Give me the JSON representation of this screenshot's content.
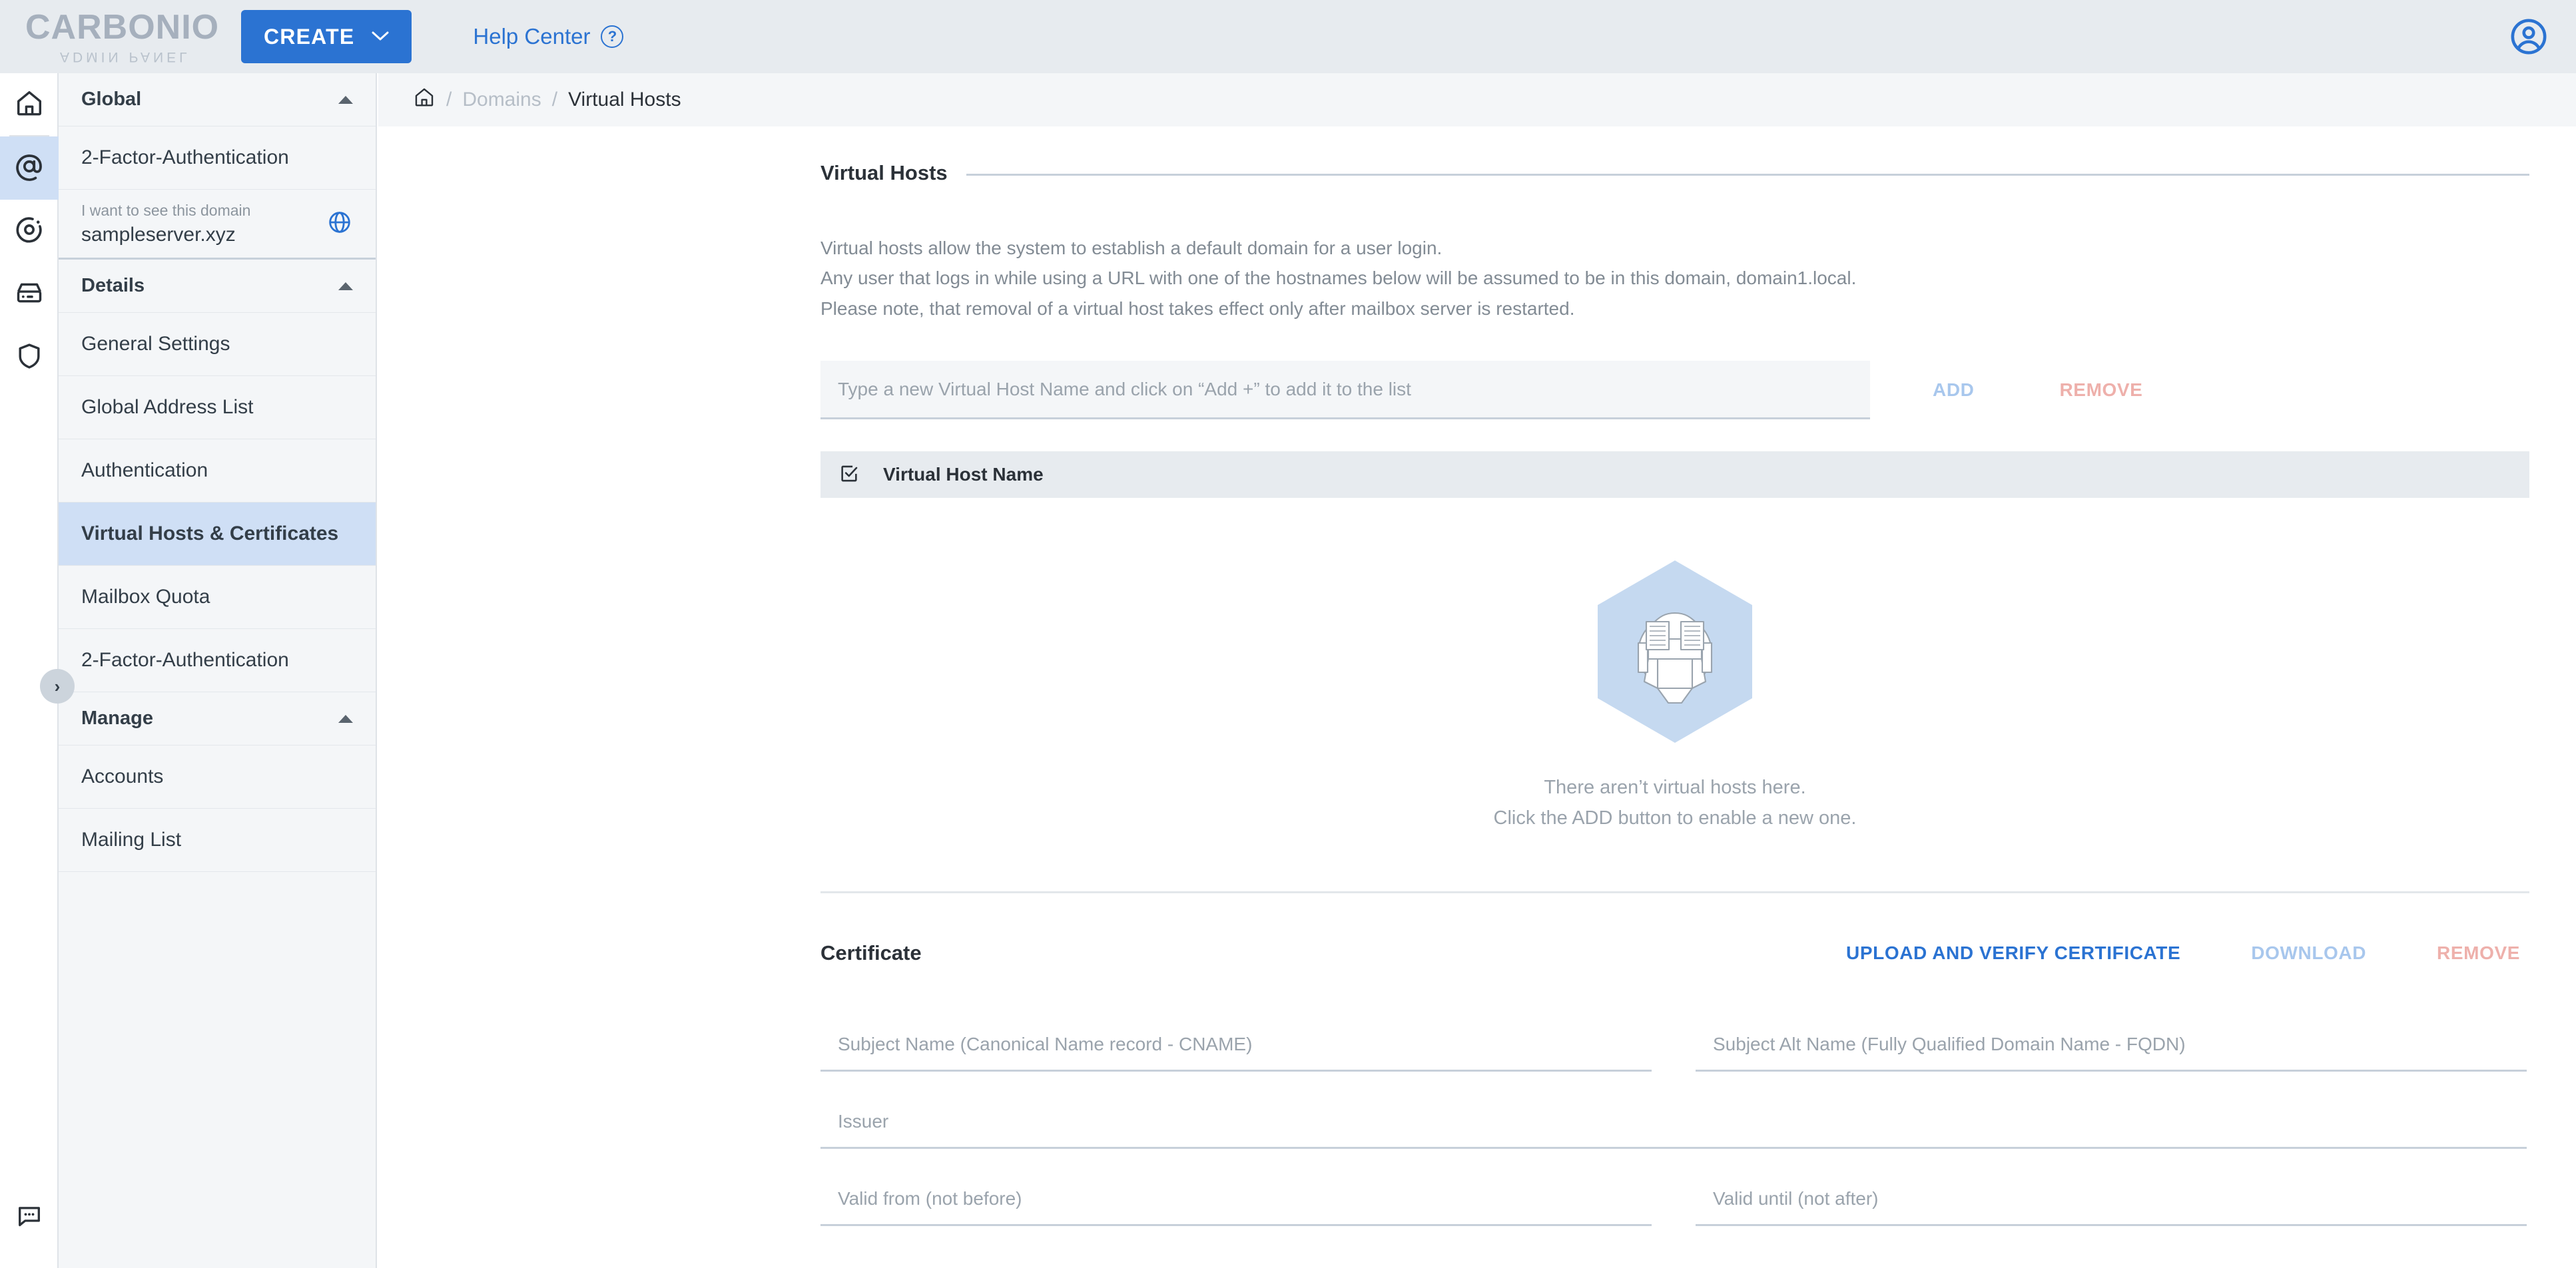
{
  "topbar": {
    "logo_main": "CARBONIO",
    "logo_sub": "ADMIN PANEL",
    "create_label": "CREATE",
    "create_chevron": "chevron-down-icon",
    "help_label": "Help Center",
    "help_icon": "question-circle-icon",
    "account_icon": "account-circle-icon"
  },
  "rail": {
    "items": [
      {
        "icon": "home-icon",
        "active": false
      },
      {
        "icon": "at-sign-domains-icon",
        "active": true
      },
      {
        "icon": "target-circle-icon",
        "active": false
      },
      {
        "icon": "server-drive-icon",
        "active": false
      },
      {
        "icon": "shield-icon",
        "active": false
      }
    ],
    "bottom_icon": "chat-bubble-icon"
  },
  "breadcrumb": {
    "home_icon": "home-icon",
    "sep": "/",
    "parent": "Domains",
    "current": "Virtual Hosts"
  },
  "sidebar": {
    "collapse_handle_icon": "chevron-right-icon",
    "groups": [
      {
        "title": "Global",
        "caret": "chevron-up-icon",
        "items": [
          {
            "label": "2-Factor-Authentication",
            "active": false
          }
        ]
      },
      {
        "title": "Details",
        "caret": "chevron-up-icon",
        "items": [
          {
            "label": "General Settings",
            "active": false
          },
          {
            "label": "Global Address List",
            "active": false
          },
          {
            "label": "Authentication",
            "active": false
          },
          {
            "label": "Virtual Hosts & Certificates",
            "active": true
          },
          {
            "label": "Mailbox Quota",
            "active": false
          },
          {
            "label": "2-Factor-Authentication",
            "active": false
          }
        ]
      },
      {
        "title": "Manage",
        "caret": "chevron-up-icon",
        "items": [
          {
            "label": "Accounts",
            "active": false
          },
          {
            "label": "Mailing List",
            "active": false
          }
        ]
      }
    ],
    "domain_selector": {
      "label": "I want to see this domain",
      "value": "sampleserver.xyz",
      "icon": "globe-icon"
    }
  },
  "main": {
    "section_title": "Virtual Hosts",
    "description": [
      "Virtual hosts allow the system to establish a default domain for a user login.",
      "Any user that logs in while using a URL with one of the hostnames below will be assumed to be in this domain, domain1.local.",
      "Please note, that removal of a virtual host takes effect only after mailbox server is restarted."
    ],
    "add_row": {
      "input_value": "",
      "input_placeholder": "Type a new Virtual Host Name and click on “Add +” to add it to the list",
      "add_label": "ADD",
      "remove_label": "REMOVE"
    },
    "table": {
      "select_all_icon": "checkbox-checked-icon",
      "column_header": "Virtual Host Name",
      "rows": []
    },
    "empty_state": {
      "illustration": "hexagon-server-illustration",
      "line1": "There aren’t virtual hosts here.",
      "line2": "Click the ADD button to enable a new one."
    },
    "certificate": {
      "title": "Certificate",
      "upload_label": "UPLOAD AND VERIFY CERTIFICATE",
      "download_label": "DOWNLOAD",
      "remove_label": "REMOVE",
      "fields": [
        {
          "value": "",
          "placeholder": "Subject Name (Canonical Name record - CNAME)"
        },
        {
          "value": "",
          "placeholder": "Subject Alt Name (Fully Qualified Domain Name - FQDN)"
        },
        {
          "value": "",
          "placeholder": "Issuer"
        },
        {
          "value": "",
          "placeholder": "Valid from (not before)"
        },
        {
          "value": "",
          "placeholder": "Valid until (not after)"
        }
      ]
    }
  },
  "colors": {
    "brand_blue": "#2b73d2",
    "accent_selected": "#cfdff5",
    "disabled_blue": "#a8c7ed",
    "disabled_red": "#eeb0ab",
    "topbar_bg": "#e7ebef",
    "sidebar_bg": "#f4f6f8",
    "hex_illustration": "#c5d9f0"
  }
}
